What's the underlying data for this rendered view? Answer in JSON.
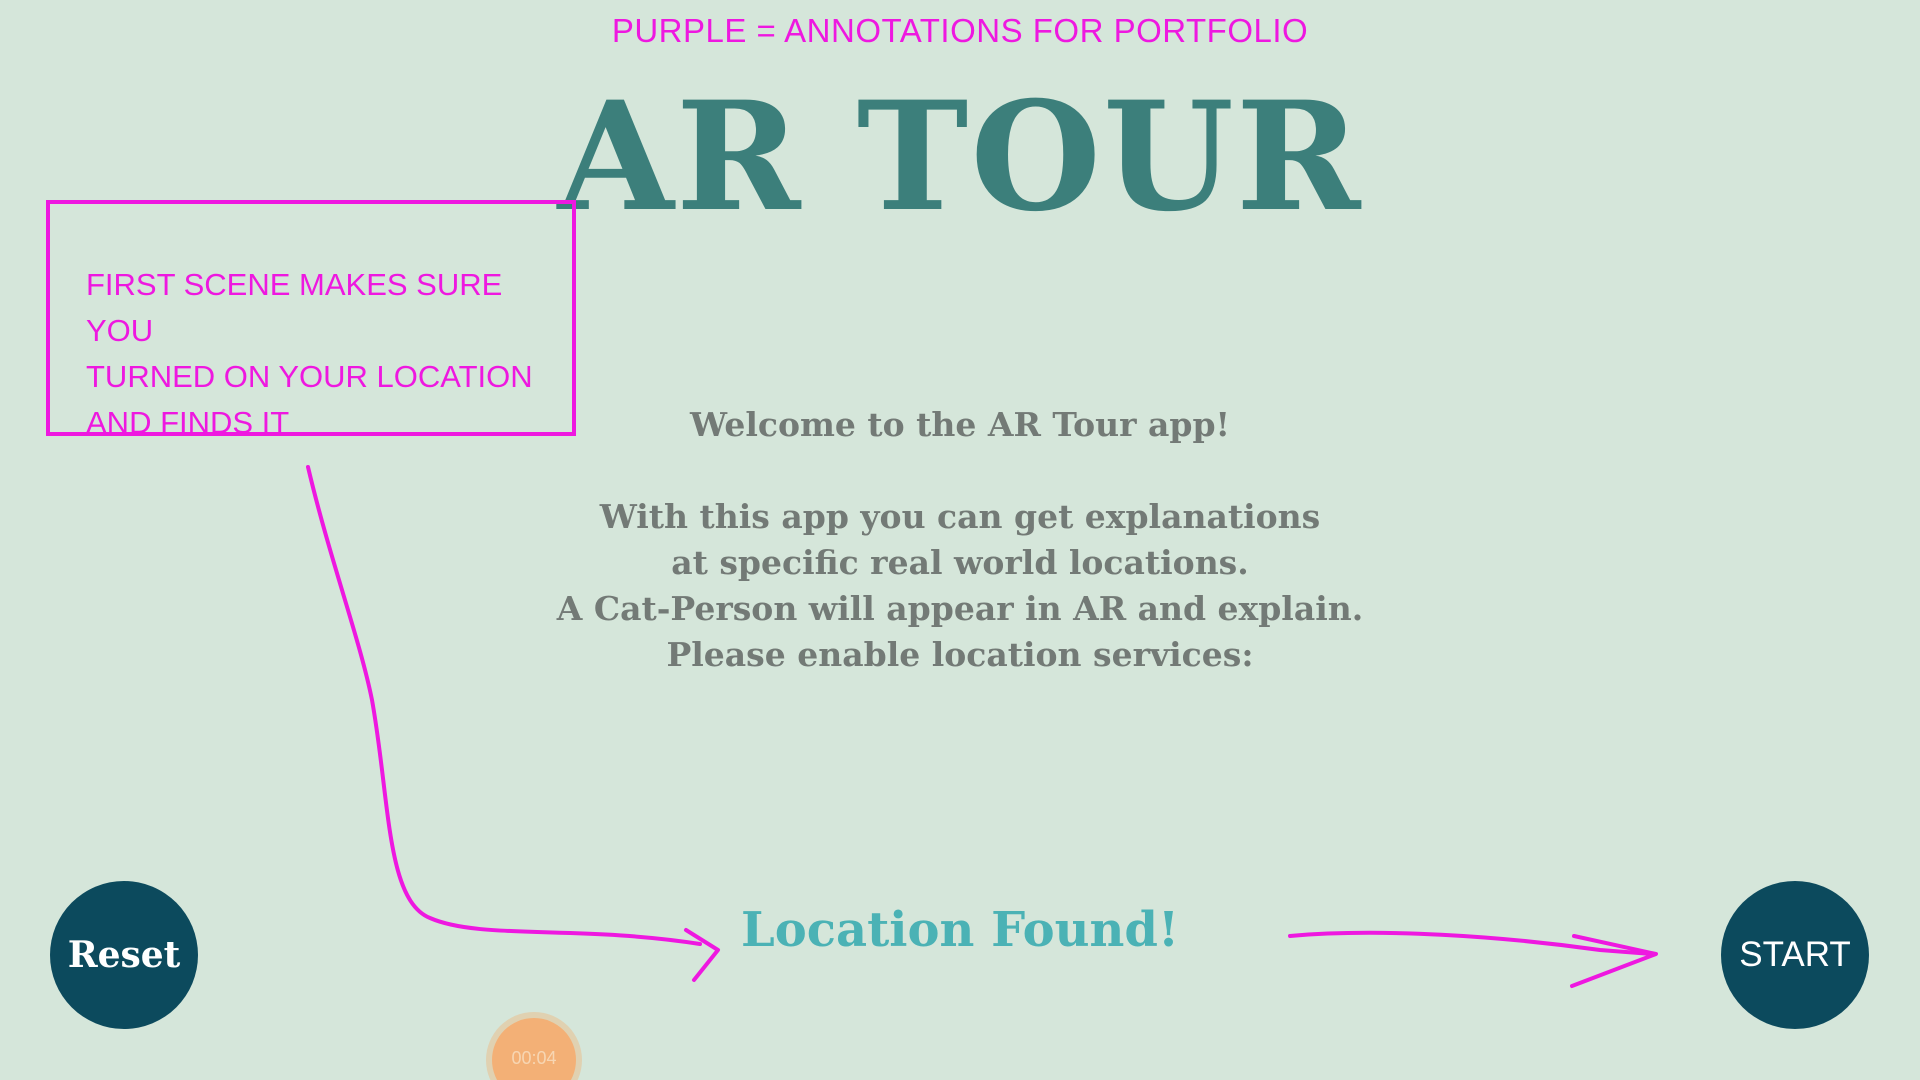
{
  "annotation_header": "PURPLE = ANNOTATIONS FOR PORTFOLIO",
  "app": {
    "title": "AR TOUR",
    "welcome_heading": "Welcome to the AR Tour app!",
    "body_lines": [
      "With this app you can get explanations",
      "at specific real world locations.",
      "A Cat-Person will appear in AR and explain.",
      "Please enable location services:"
    ],
    "status_text": "Location Found!",
    "reset_label": "Reset",
    "start_label": "START",
    "timer": "00:04"
  },
  "annotation_box": {
    "lines": [
      "FIRST SCENE MAKES SURE YOU",
      "TURNED ON YOUR LOCATION",
      "AND FINDS IT"
    ]
  },
  "colors": {
    "background": "#d5e6da",
    "annotation": "#ee18e0",
    "title": "#3c7f7b",
    "body_text": "#737a76",
    "status": "#4bb2b5",
    "button": "#0c4a5d",
    "timer": "#f3b076"
  }
}
